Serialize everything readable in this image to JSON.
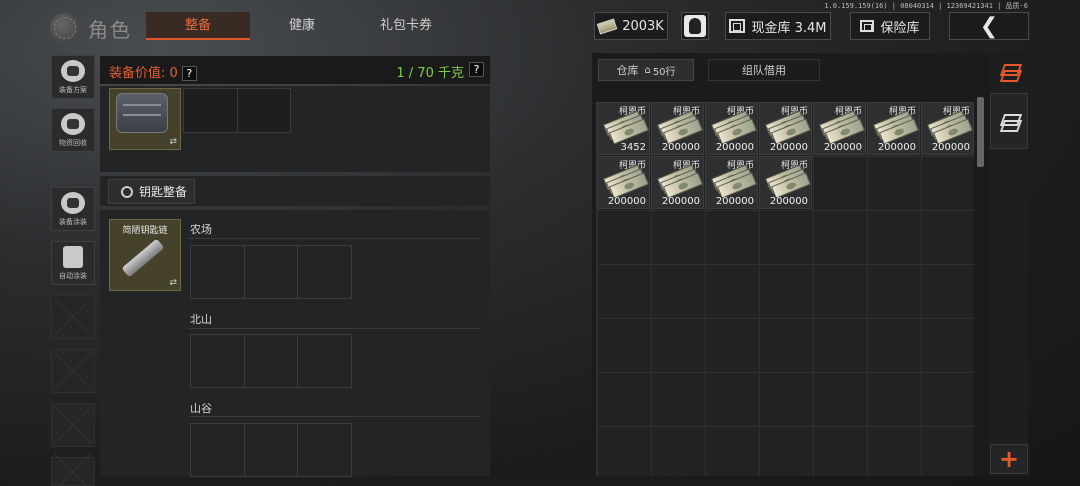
{
  "version": "1.0.159.159(16) | 08040314 | 12369421341 | 品质-6",
  "header": {
    "title": "角色",
    "tabs": [
      "整备",
      "健康",
      "礼包卡券"
    ],
    "money": "2003K",
    "cash_vault": "现金库 3.4M",
    "vault": "保险库"
  },
  "rail": [
    {
      "label": "装备方案",
      "icon": "helmet-icon"
    },
    {
      "label": "物资回收",
      "icon": "recycle-icon"
    },
    {
      "label": "装备涂装",
      "icon": "operator-paint-icon"
    },
    {
      "label": "自动涂装",
      "icon": "auto-paint-icon"
    }
  ],
  "loadout": {
    "value_label": "装备价值: 0",
    "weight": "1 / 70 千克",
    "help": "?"
  },
  "key_section": {
    "title": "钥匙整备",
    "keychain_name": "简陋钥匙链",
    "maps": [
      "农场",
      "北山",
      "山谷"
    ]
  },
  "warehouse": {
    "tab_label": "仓库",
    "rows_label": "50行",
    "team_tab": "组队借用",
    "items": [
      {
        "name": "柯恩币",
        "qty": "3452"
      },
      {
        "name": "柯恩币",
        "qty": "200000"
      },
      {
        "name": "柯恩币",
        "qty": "200000"
      },
      {
        "name": "柯恩币",
        "qty": "200000"
      },
      {
        "name": "柯恩币",
        "qty": "200000"
      },
      {
        "name": "柯恩币",
        "qty": "200000"
      },
      {
        "name": "柯恩币",
        "qty": "200000"
      },
      {
        "name": "柯恩币",
        "qty": "200000"
      },
      {
        "name": "柯恩币",
        "qty": "200000"
      },
      {
        "name": "柯恩币",
        "qty": "200000"
      },
      {
        "name": "柯恩币",
        "qty": "200000"
      }
    ]
  },
  "side_icons": [
    "sort-layers-icon",
    "deposit-layers-icon",
    "add-icon"
  ],
  "colors": {
    "accent": "#e0532a",
    "weight_green": "#7fcc45",
    "value_orange": "#e65d2e"
  }
}
